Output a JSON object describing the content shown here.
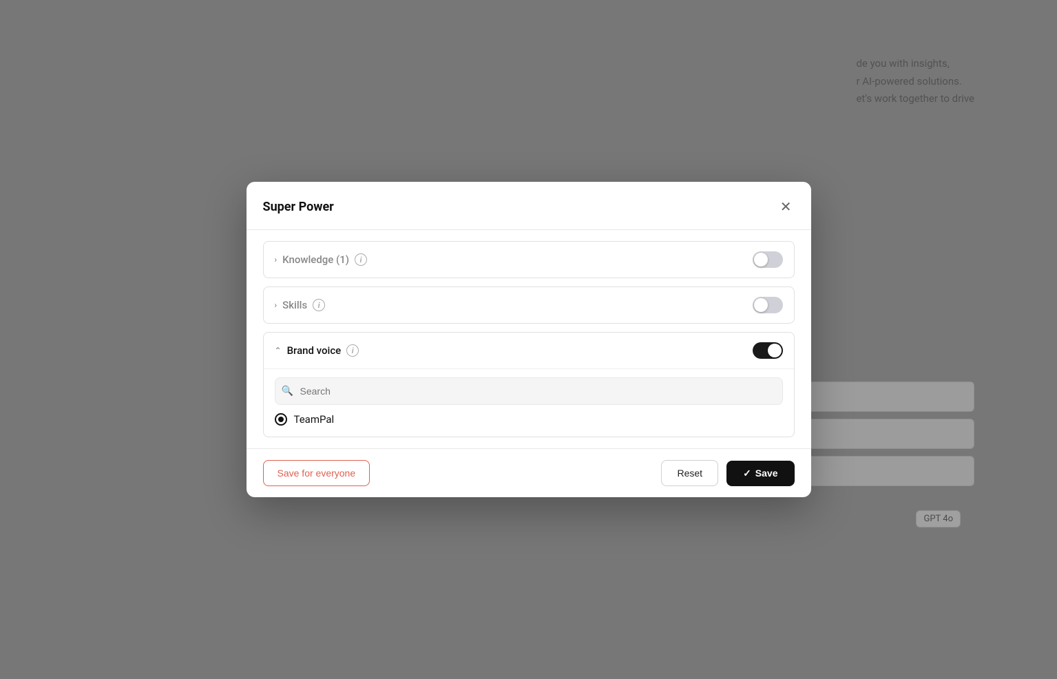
{
  "background": {
    "text_line1": "de you with insights,",
    "text_line2": "r AI-powered solutions.",
    "text_line3": "et's work together to drive"
  },
  "gpt_badge": "GPT 4o",
  "modal": {
    "title": "Super Power",
    "close_label": "×",
    "sections": {
      "knowledge": {
        "label": "Knowledge (1)",
        "toggle_state": "off",
        "collapsed": true
      },
      "skills": {
        "label": "Skills",
        "toggle_state": "off",
        "collapsed": true
      },
      "brand_voice": {
        "label": "Brand voice",
        "toggle_state": "on",
        "expanded": true,
        "search_placeholder": "Search",
        "options": [
          {
            "label": "TeamPal",
            "selected": true
          }
        ]
      }
    },
    "footer": {
      "save_everyone_label": "Save for everyone",
      "reset_label": "Reset",
      "save_label": "Save"
    }
  }
}
